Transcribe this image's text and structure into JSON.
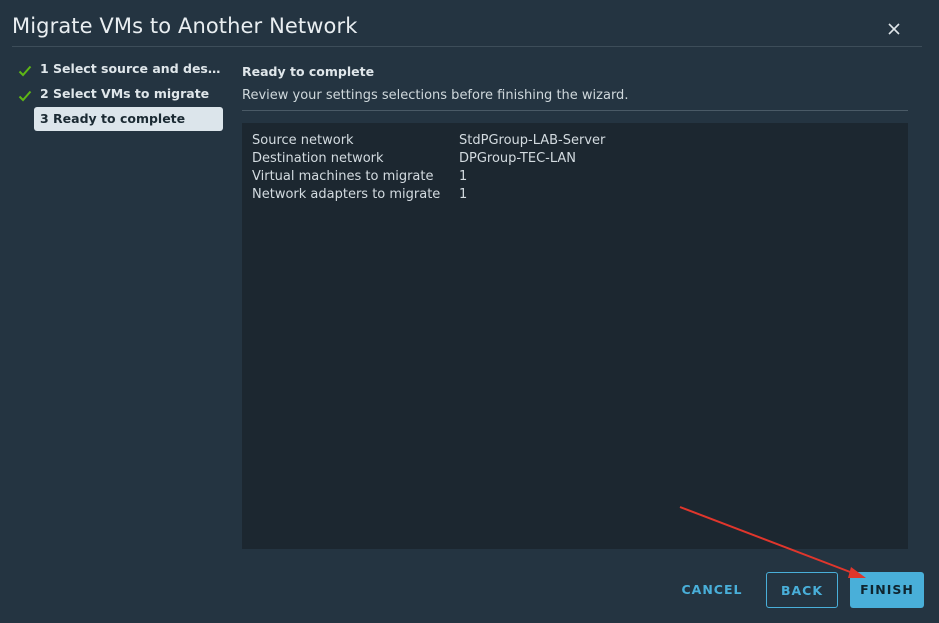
{
  "dialog": {
    "title": "Migrate VMs to Another Network",
    "close_icon": "close-icon"
  },
  "steps": [
    {
      "label": "1 Select source and destina...",
      "completed": true,
      "active": false
    },
    {
      "label": "2 Select VMs to migrate",
      "completed": true,
      "active": false
    },
    {
      "label": "3 Ready to complete",
      "completed": false,
      "active": true
    }
  ],
  "content": {
    "title": "Ready to complete",
    "description": "Review your settings selections before finishing the wizard."
  },
  "summary": {
    "rows": [
      {
        "key": "Source network",
        "value": "StdPGroup-LAB-Server"
      },
      {
        "key": "Destination network",
        "value": "DPGroup-TEC-LAN"
      },
      {
        "key": "Virtual machines to migrate",
        "value": "1"
      },
      {
        "key": "Network adapters to migrate",
        "value": "1"
      }
    ]
  },
  "buttons": {
    "cancel": "CANCEL",
    "back": "BACK",
    "finish": "FINISH"
  },
  "colors": {
    "background": "#243441",
    "accent": "#49afd9",
    "check": "#5eb715",
    "annotation_arrow": "#e0362c"
  }
}
